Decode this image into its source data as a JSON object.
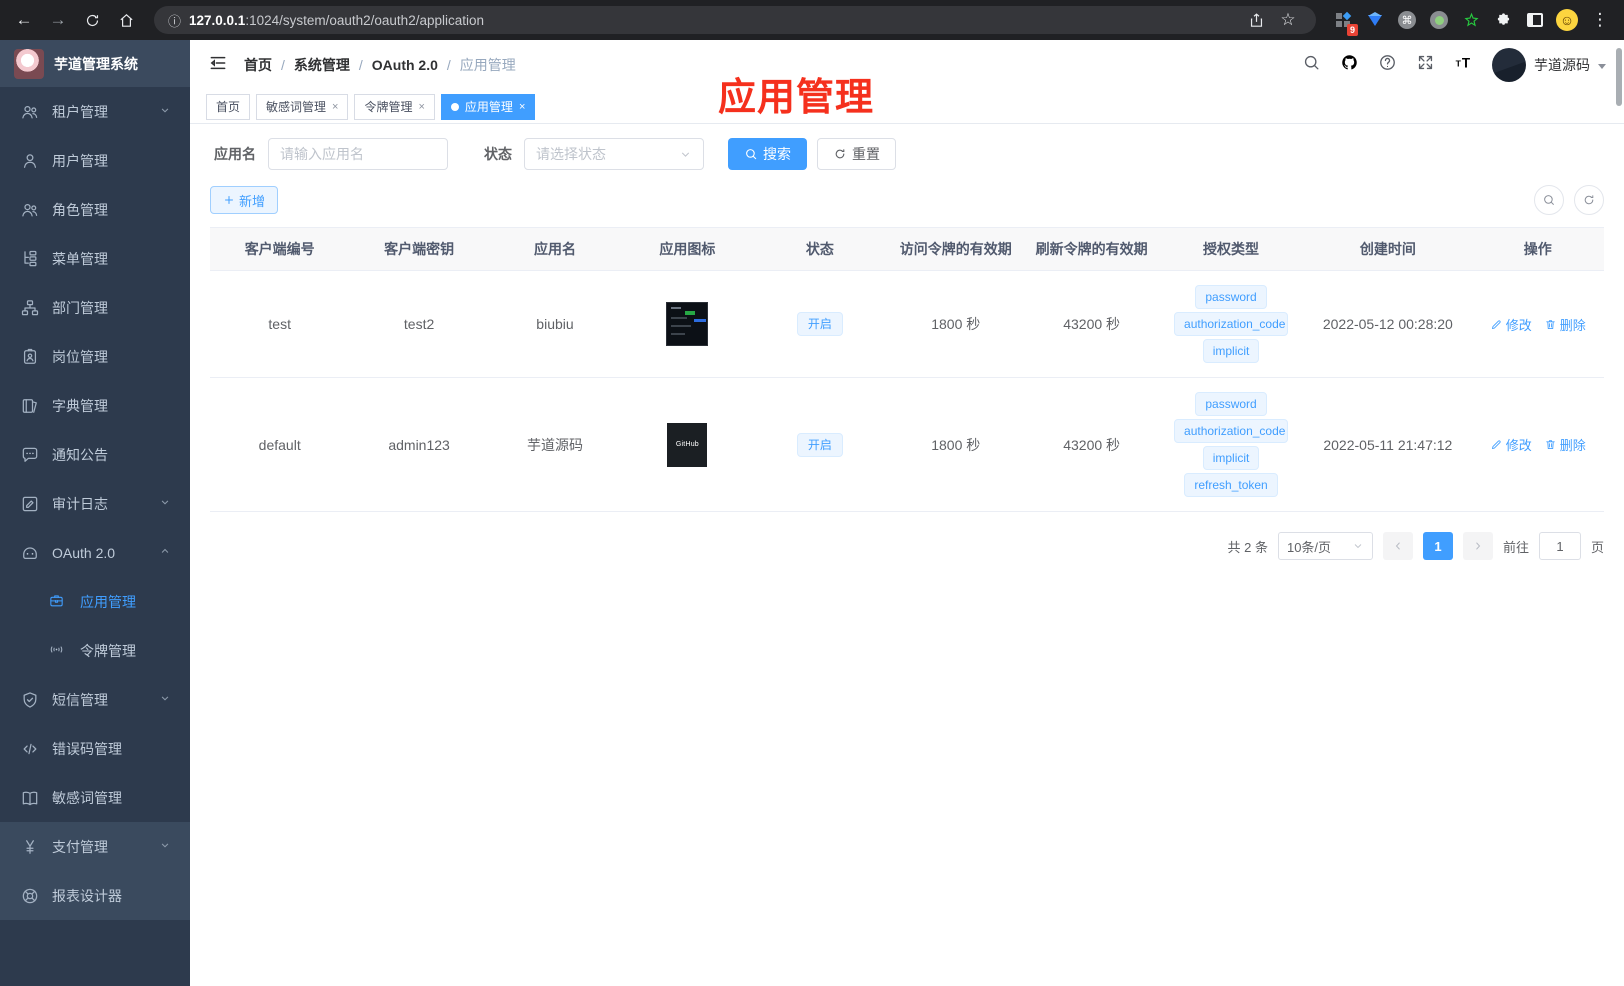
{
  "browser": {
    "url_host": "127.0.0.1",
    "url_path": ":1024/system/oauth2/oauth2/application",
    "extension_badge": "9"
  },
  "sidebar": {
    "logo_title": "芋道管理系统",
    "items": [
      {
        "icon": "users",
        "label": "租户管理",
        "chevron": "down"
      },
      {
        "icon": "user",
        "label": "用户管理"
      },
      {
        "icon": "users",
        "label": "角色管理"
      },
      {
        "icon": "tree",
        "label": "菜单管理"
      },
      {
        "icon": "org",
        "label": "部门管理"
      },
      {
        "icon": "badge",
        "label": "岗位管理"
      },
      {
        "icon": "books",
        "label": "字典管理"
      },
      {
        "icon": "message",
        "label": "通知公告"
      },
      {
        "icon": "log",
        "label": "审计日志",
        "chevron": "down"
      },
      {
        "icon": "robot",
        "label": "OAuth 2.0",
        "chevron": "up"
      },
      {
        "icon": "briefcase",
        "label": "应用管理",
        "sub": true,
        "active": true
      },
      {
        "icon": "signal",
        "label": "令牌管理",
        "sub": true
      },
      {
        "icon": "shield",
        "label": "短信管理",
        "chevron": "down"
      },
      {
        "icon": "code",
        "label": "错误码管理"
      },
      {
        "icon": "book",
        "label": "敏感词管理"
      },
      {
        "icon": "yen",
        "label": "支付管理",
        "chevron": "down",
        "light": true
      },
      {
        "icon": "compass",
        "label": "报表设计器",
        "light": true
      }
    ]
  },
  "header": {
    "breadcrumb": [
      "首页",
      "系统管理",
      "OAuth 2.0",
      "应用管理"
    ],
    "action_icons": [
      "search",
      "github",
      "question",
      "fullscreen",
      "fontsize"
    ],
    "user_name": "芋道源码"
  },
  "tabs": [
    {
      "label": "首页"
    },
    {
      "label": "敏感词管理",
      "closable": true
    },
    {
      "label": "令牌管理",
      "closable": true
    },
    {
      "label": "应用管理",
      "closable": true,
      "active": true
    }
  ],
  "annotation": {
    "text": "应用管理",
    "color": "#f5301d"
  },
  "filters": {
    "name_label": "应用名",
    "name_placeholder": "请输入应用名",
    "status_label": "状态",
    "status_placeholder": "请选择状态",
    "search_label": "搜索",
    "reset_label": "重置"
  },
  "toolbar": {
    "add_label": "新增"
  },
  "table": {
    "columns": [
      "客户端编号",
      "客户端密钥",
      "应用名",
      "应用图标",
      "状态",
      "访问令牌的有效期",
      "刷新令牌的有效期",
      "授权类型",
      "创建时间",
      "操作"
    ],
    "action_labels": {
      "edit": "修改",
      "delete": "删除"
    },
    "rows": [
      {
        "client_id": "test",
        "secret": "test2",
        "name": "biubiu",
        "icon": "dashboard-screenshot",
        "status": "开启",
        "access_validity": "1800 秒",
        "refresh_validity": "43200 秒",
        "grant_types": [
          "password",
          "authorization_code",
          "implicit"
        ],
        "created": "2022-05-12 00:28:20"
      },
      {
        "client_id": "default",
        "secret": "admin123",
        "name": "芋道源码",
        "icon": "github-dark",
        "icon_text": "GitHub",
        "status": "开启",
        "access_validity": "1800 秒",
        "refresh_validity": "43200 秒",
        "grant_types": [
          "password",
          "authorization_code",
          "implicit",
          "refresh_token"
        ],
        "created": "2022-05-11 21:47:12"
      }
    ]
  },
  "pagination": {
    "total_text": "共 2 条",
    "page_size": "10条/页",
    "current_page": "1",
    "goto_label": "前往",
    "goto_value": "1",
    "page_suffix": "页"
  },
  "colors": {
    "accent": "#409eff",
    "sidebar_bg": "#2d3a4d",
    "annotation_red": "#f5301d"
  }
}
